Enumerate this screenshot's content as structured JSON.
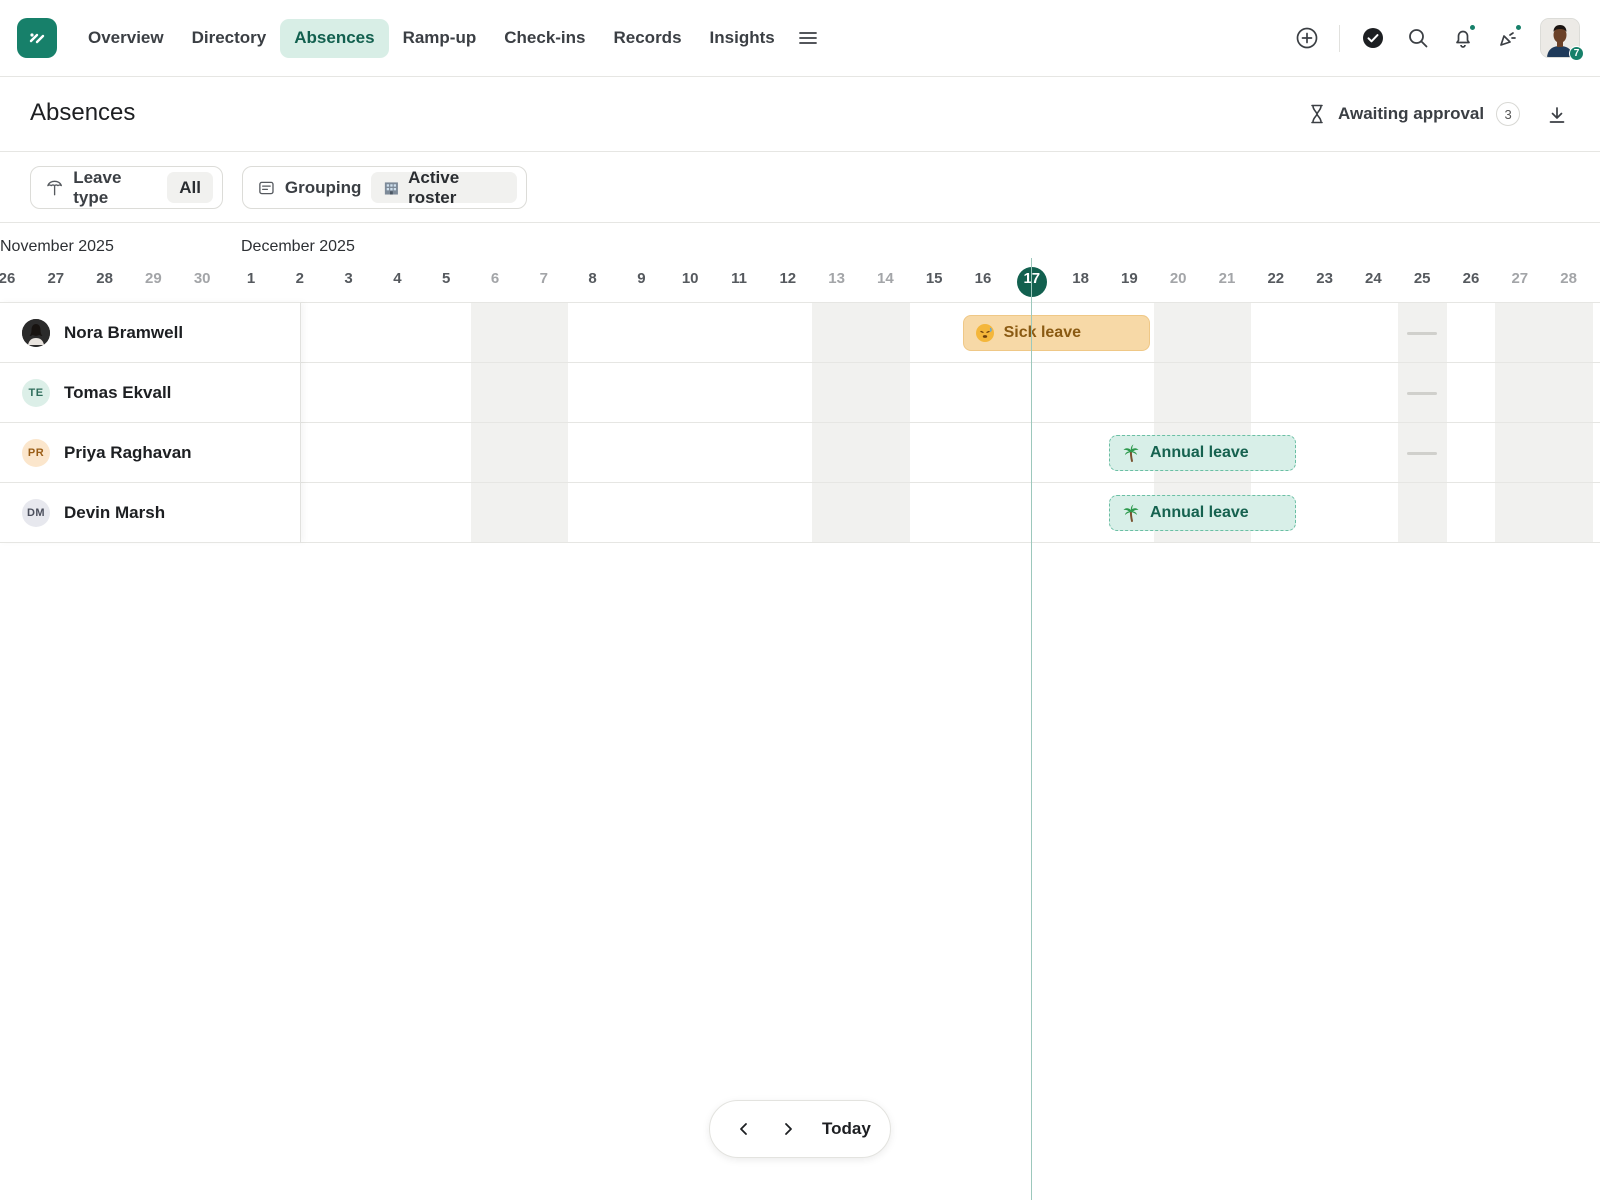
{
  "nav": {
    "items": [
      {
        "label": "Overview",
        "active": false
      },
      {
        "label": "Directory",
        "active": false
      },
      {
        "label": "Absences",
        "active": true
      },
      {
        "label": "Ramp-up",
        "active": false
      },
      {
        "label": "Check-ins",
        "active": false
      },
      {
        "label": "Records",
        "active": false
      },
      {
        "label": "Insights",
        "active": false
      }
    ],
    "menu_icon": "hamburger-icon",
    "actions": [
      "add-circle-icon",
      "check-circle-icon",
      "search-icon",
      "bell-icon",
      "announcement-icon"
    ],
    "profile_badge": "7"
  },
  "header": {
    "title": "Absences",
    "approval_label": "Awaiting approval",
    "approval_count": "3"
  },
  "filters": {
    "leave_type_label": "Leave type",
    "leave_type_value": "All",
    "grouping_label": "Grouping",
    "grouping_value": "Active roster"
  },
  "calendar": {
    "months": [
      "November 2025",
      "December 2025"
    ],
    "days": [
      {
        "n": "26",
        "weekend": false
      },
      {
        "n": "27",
        "weekend": false
      },
      {
        "n": "28",
        "weekend": false
      },
      {
        "n": "29",
        "weekend": true
      },
      {
        "n": "30",
        "weekend": true
      },
      {
        "n": "1",
        "weekend": false
      },
      {
        "n": "2",
        "weekend": false
      },
      {
        "n": "3",
        "weekend": false
      },
      {
        "n": "4",
        "weekend": false
      },
      {
        "n": "5",
        "weekend": false
      },
      {
        "n": "6",
        "weekend": true
      },
      {
        "n": "7",
        "weekend": true
      },
      {
        "n": "8",
        "weekend": false
      },
      {
        "n": "9",
        "weekend": false
      },
      {
        "n": "10",
        "weekend": false
      },
      {
        "n": "11",
        "weekend": false
      },
      {
        "n": "12",
        "weekend": false
      },
      {
        "n": "13",
        "weekend": true
      },
      {
        "n": "14",
        "weekend": true
      },
      {
        "n": "15",
        "weekend": false
      },
      {
        "n": "16",
        "weekend": false
      },
      {
        "n": "17",
        "weekend": false,
        "today": true
      },
      {
        "n": "18",
        "weekend": false
      },
      {
        "n": "19",
        "weekend": false
      },
      {
        "n": "20",
        "weekend": true
      },
      {
        "n": "21",
        "weekend": true
      },
      {
        "n": "22",
        "weekend": false
      },
      {
        "n": "23",
        "weekend": false
      },
      {
        "n": "24",
        "weekend": false
      },
      {
        "n": "25",
        "weekend": false,
        "holiday": true
      },
      {
        "n": "26",
        "weekend": false
      },
      {
        "n": "27",
        "weekend": true
      },
      {
        "n": "28",
        "weekend": true
      }
    ],
    "people": [
      {
        "name": "Nora Bramwell",
        "initials": "",
        "avatar": "photo",
        "bg": "#2b2b2b",
        "fg": "#ffffff"
      },
      {
        "name": "Tomas Ekvall",
        "initials": "TE",
        "avatar": "initials",
        "bg": "#dcefe8",
        "fg": "#2f6e5c"
      },
      {
        "name": "Priya Raghavan",
        "initials": "PR",
        "avatar": "initials",
        "bg": "#fbe6cc",
        "fg": "#9a5d16"
      },
      {
        "name": "Devin Marsh",
        "initials": "DM",
        "avatar": "initials",
        "bg": "#e7e8ee",
        "fg": "#4b4f5c"
      }
    ],
    "leaves": [
      {
        "person": 0,
        "label": "Sick leave",
        "kind": "sick",
        "icon": "sick-face-icon",
        "start_index": 20,
        "end_index": 23
      },
      {
        "person": 2,
        "label": "Annual leave",
        "kind": "annual",
        "icon": "palm-tree-icon",
        "start_index": 23,
        "end_index": 26
      },
      {
        "person": 3,
        "label": "Annual leave",
        "kind": "annual",
        "icon": "palm-tree-icon",
        "start_index": 23,
        "end_index": 26
      }
    ]
  },
  "pager": {
    "prev_icon": "chevron-left-icon",
    "next_icon": "chevron-right-icon",
    "today_label": "Today"
  },
  "colors": {
    "brand": "#17806a",
    "active_tab_bg": "#d8eee6",
    "sick": "#f7d9a7",
    "annual": "#d8efe8",
    "weekend": "#f1f1ef"
  }
}
